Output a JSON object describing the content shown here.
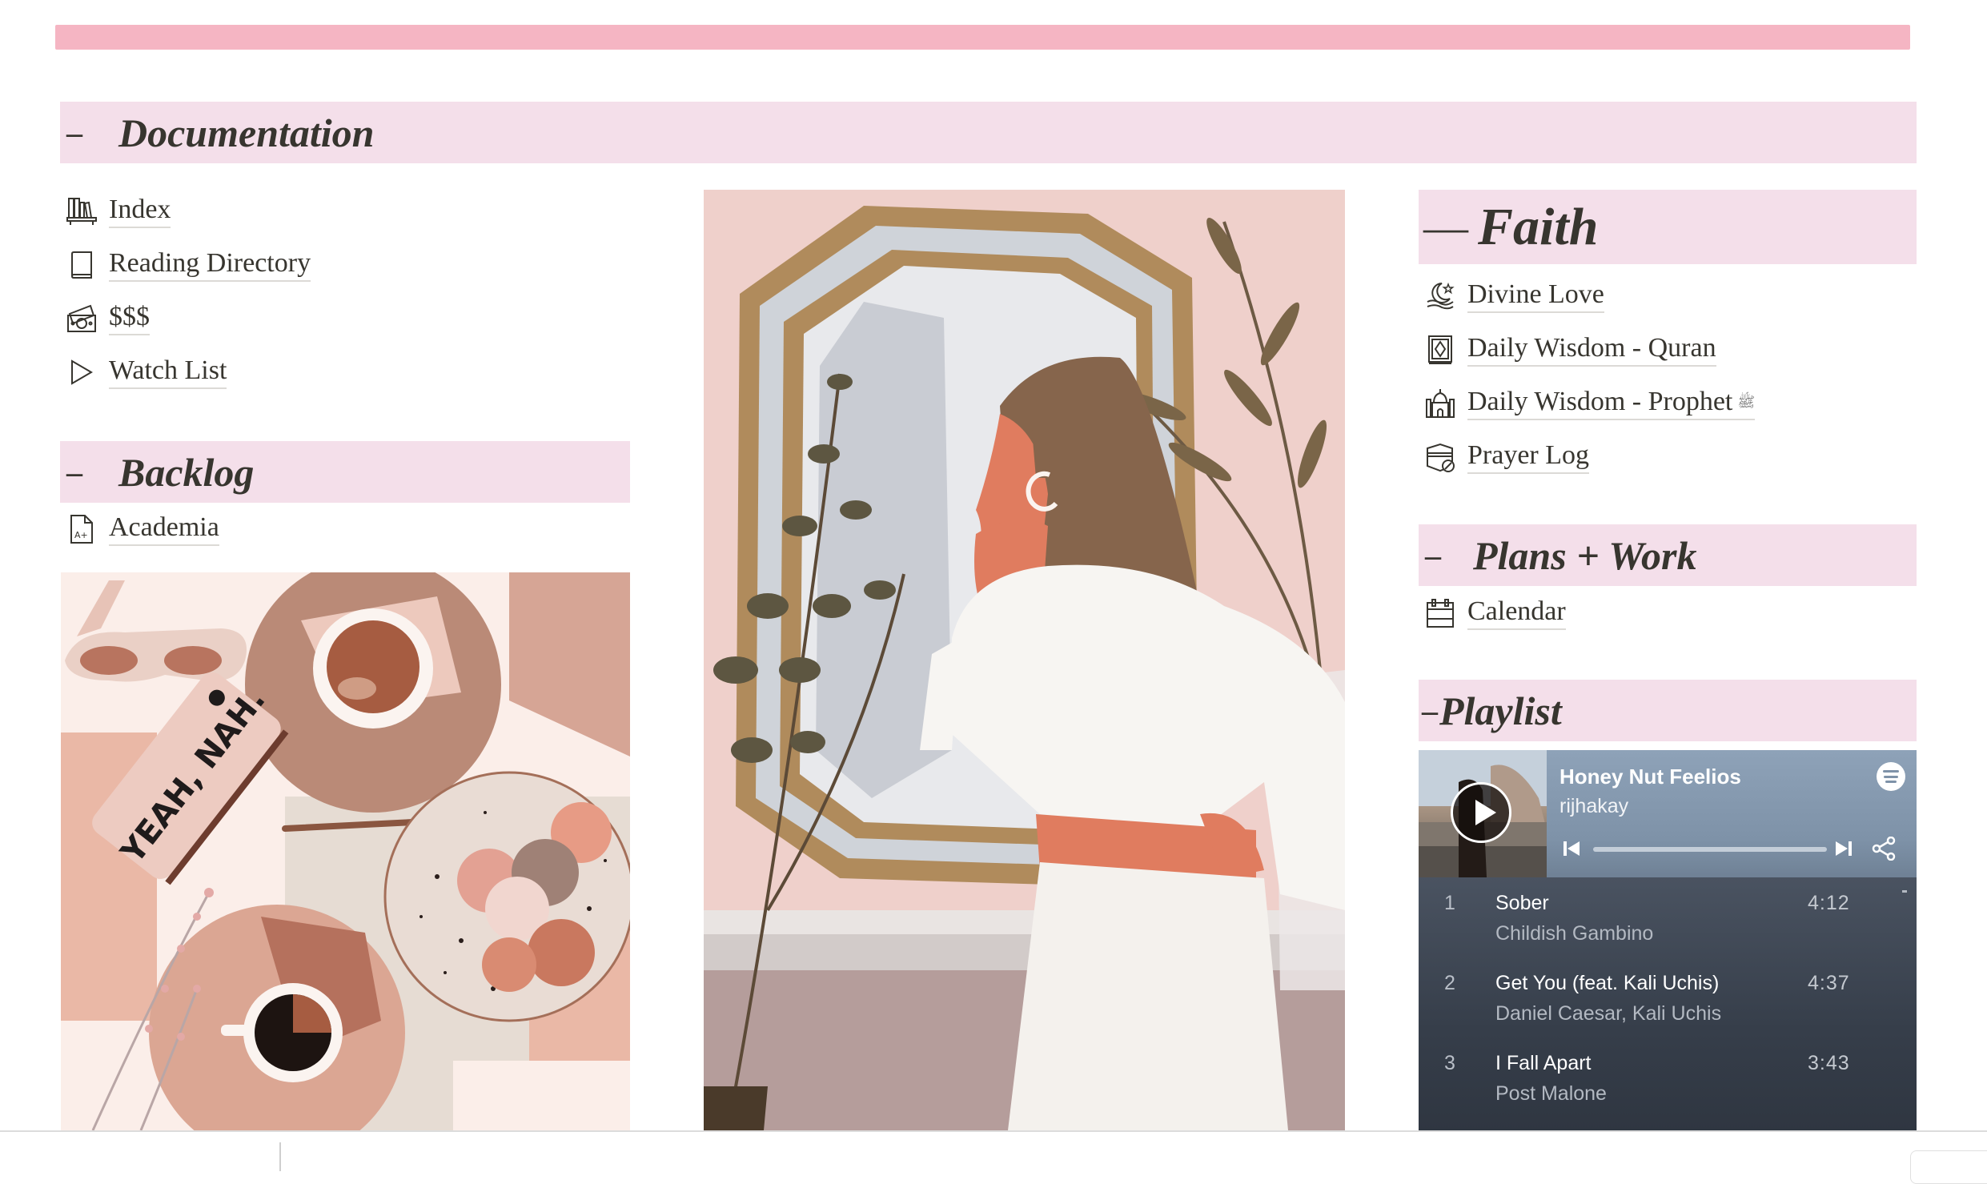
{
  "colors": {
    "cover_bar": "#f5b5c3",
    "header_bg": "#f4dfea",
    "text": "#37352f",
    "spotify_header": "#7e92a8",
    "spotify_list": "#3b4452"
  },
  "documentation": {
    "dash": "–",
    "title": "Documentation",
    "items": [
      {
        "icon": "bookshelf-icon",
        "label": "Index"
      },
      {
        "icon": "book-icon",
        "label": "Reading Directory"
      },
      {
        "icon": "money-icon",
        "label": "$$$"
      },
      {
        "icon": "play-triangle-icon",
        "label": "Watch List"
      }
    ]
  },
  "backlog": {
    "dash": "–",
    "title": "Backlog",
    "items": [
      {
        "icon": "grade-document-icon",
        "label": "Academia"
      }
    ]
  },
  "images": {
    "coffee_illustration": {
      "alt": "Flat-lay illustration of coffee cups, macarons, sunglasses and a phone",
      "phone_text": "YEAH, NAH."
    },
    "woman_illustration": {
      "alt": "Illustration of a woman looking into an octagonal mirror with plants"
    }
  },
  "faith": {
    "dash": "—",
    "title": "Faith",
    "items": [
      {
        "icon": "crescent-hand-icon",
        "label": "Divine Love",
        "suffix": ""
      },
      {
        "icon": "quran-icon",
        "label": "Daily Wisdom - Quran",
        "suffix": ""
      },
      {
        "icon": "mosque-icon",
        "label": "Daily Wisdom - Prophet",
        "suffix": "ﷺ"
      },
      {
        "icon": "kaaba-icon",
        "label": "Prayer Log",
        "suffix": ""
      }
    ]
  },
  "plans": {
    "dash": "–",
    "title": "Plans + Work",
    "items": [
      {
        "icon": "calendar-icon",
        "label": "Calendar"
      }
    ]
  },
  "playlist": {
    "dash": "–",
    "title": "Playlist",
    "player": {
      "title": "Honey Nut Feelios",
      "artist": "rijhakay",
      "progress": 0,
      "tracks": [
        {
          "num": "1",
          "name": "Sober",
          "artist": "Childish Gambino",
          "duration": "4:12"
        },
        {
          "num": "2",
          "name": "Get You (feat. Kali Uchis)",
          "artist": "Daniel Caesar, Kali Uchis",
          "duration": "4:37"
        },
        {
          "num": "3",
          "name": "I Fall Apart",
          "artist": "Post Malone",
          "duration": "3:43"
        }
      ]
    }
  }
}
